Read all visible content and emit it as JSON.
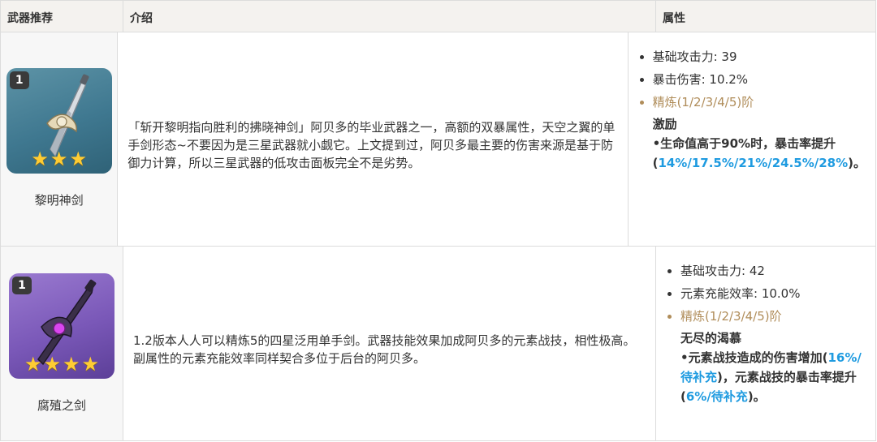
{
  "header": {
    "col_weapon": "武器推荐",
    "col_intro": "介绍",
    "col_attr": "属性"
  },
  "rows": [
    {
      "weapon": {
        "name": "黎明神剑",
        "refine": "1",
        "stars": 3,
        "card_color": "#3f7890"
      },
      "intro": "「斩开黎明指向胜利的拂晓神剑」阿贝多的毕业武器之一，高额的双暴属性，天空之翼的单手剑形态~不要因为是三星武器就小觑它。上文提到过，阿贝多最主要的伤害来源是基于防御力计算，所以三星武器的低攻击面板完全不是劣势。",
      "attrs": [
        "基础攻击力: 39",
        "暴击伤害: 10.2%"
      ],
      "refine_label": "精炼(1/2/3/4/5)阶",
      "effect_title": "激励",
      "effect_parts": [
        {
          "text": "•生命值高于90%时，暴击率提升(",
          "hl": false
        },
        {
          "text": "14%/17.5%/21%/24.5%/28%",
          "hl": true
        },
        {
          "text": ")。",
          "hl": false
        }
      ]
    },
    {
      "weapon": {
        "name": "腐殖之剑",
        "refine": "1",
        "stars": 4,
        "card_color": "#7a58b8"
      },
      "intro": "1.2版本人人可以精炼5的四星泛用单手剑。武器技能效果加成阿贝多的元素战技，相性极高。副属性的元素充能效率同样契合多位于后台的阿贝多。",
      "attrs": [
        "基础攻击力: 42",
        "元素充能效率: 10.0%"
      ],
      "refine_label": "精炼(1/2/3/4/5)阶",
      "effect_title": "无尽的渴慕",
      "effect_parts": [
        {
          "text": "•元素战技造成的伤害增加(",
          "hl": false
        },
        {
          "text": "16%/待补充",
          "hl": true
        },
        {
          "text": ")，元素战技的暴击率提升(",
          "hl": false
        },
        {
          "text": "6%/待补充",
          "hl": true
        },
        {
          "text": ")。",
          "hl": false
        }
      ]
    }
  ],
  "colors": {
    "highlight": "#1f9be0",
    "refine": "#b08d5a",
    "star": "#ffcc33"
  }
}
